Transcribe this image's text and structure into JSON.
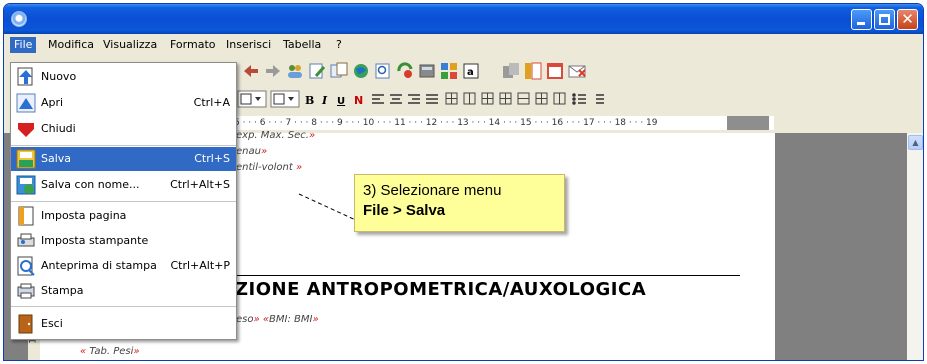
{
  "menubar": {
    "items": [
      {
        "label": "File"
      },
      {
        "label": "Modifica"
      },
      {
        "label": "Visualizza"
      },
      {
        "label": "Formato"
      },
      {
        "label": "Inserisci"
      },
      {
        "label": "Tabella"
      },
      {
        "label": "?"
      }
    ]
  },
  "file_menu": {
    "items": [
      {
        "label": "Nuovo",
        "shortcut": ""
      },
      {
        "label": "Apri",
        "shortcut": "Ctrl+A"
      },
      {
        "label": "Chiudi",
        "shortcut": ""
      },
      {
        "label": "Salva",
        "shortcut": "Ctrl+S"
      },
      {
        "label": "Salva con nome...",
        "shortcut": "Ctrl+Alt+S"
      },
      {
        "label": "Imposta pagina",
        "shortcut": ""
      },
      {
        "label": "Imposta stampante",
        "shortcut": ""
      },
      {
        "label": "Anteprima di stampa",
        "shortcut": "Ctrl+Alt+P"
      },
      {
        "label": "Stampa",
        "shortcut": ""
      },
      {
        "label": "Esci",
        "shortcut": ""
      }
    ]
  },
  "ruler": {
    "marks": "5 · · · 6 · · · 7 · · · 8 · · · 9 · · · 10 · · · 11 · · · 12 · · · 13 · · · 14 · · · 15 · · · 16 · · · 17 · · · 18 · · · 19"
  },
  "left_ruler": {
    "number": "18"
  },
  "document": {
    "field1": "exp. Max. Sec.",
    "field2": "enau",
    "field3": "entil-volont",
    "heading": "ZIONE ANTROPOMETRICA/AUXOLOGICA",
    "field4": "eso",
    "field5": "BMI: BMI",
    "field6": "Tab. Pesi"
  },
  "callout": {
    "line1": "3) Selezionare menu",
    "line2": "File > Salva"
  },
  "colors": {
    "titlebar": "#0a4fd4",
    "menu_highlight": "#316ac5",
    "callout_bg": "#ffff99",
    "field_guillemet": "#cc1f1f"
  }
}
